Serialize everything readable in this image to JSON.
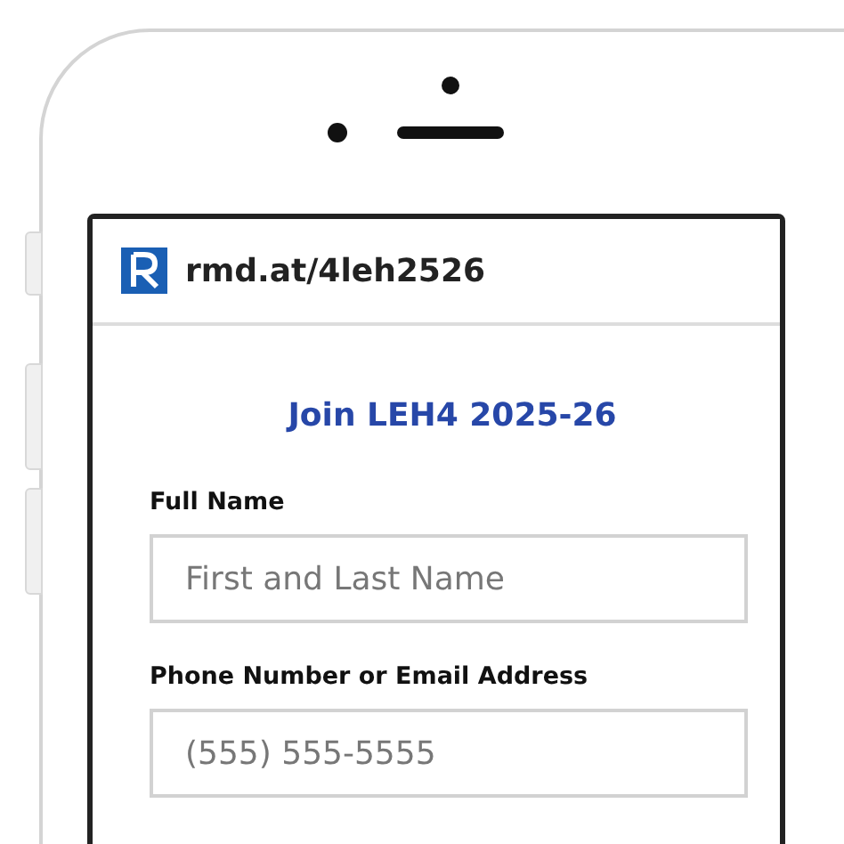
{
  "browser_bar": {
    "url": "rmd.at/4leh2526"
  },
  "form": {
    "title": "Join LEH4 2025-26",
    "fields": [
      {
        "label": "Full Name",
        "placeholder": "First and Last Name"
      },
      {
        "label": "Phone Number or Email Address",
        "placeholder": "(555) 555-5555"
      }
    ]
  }
}
